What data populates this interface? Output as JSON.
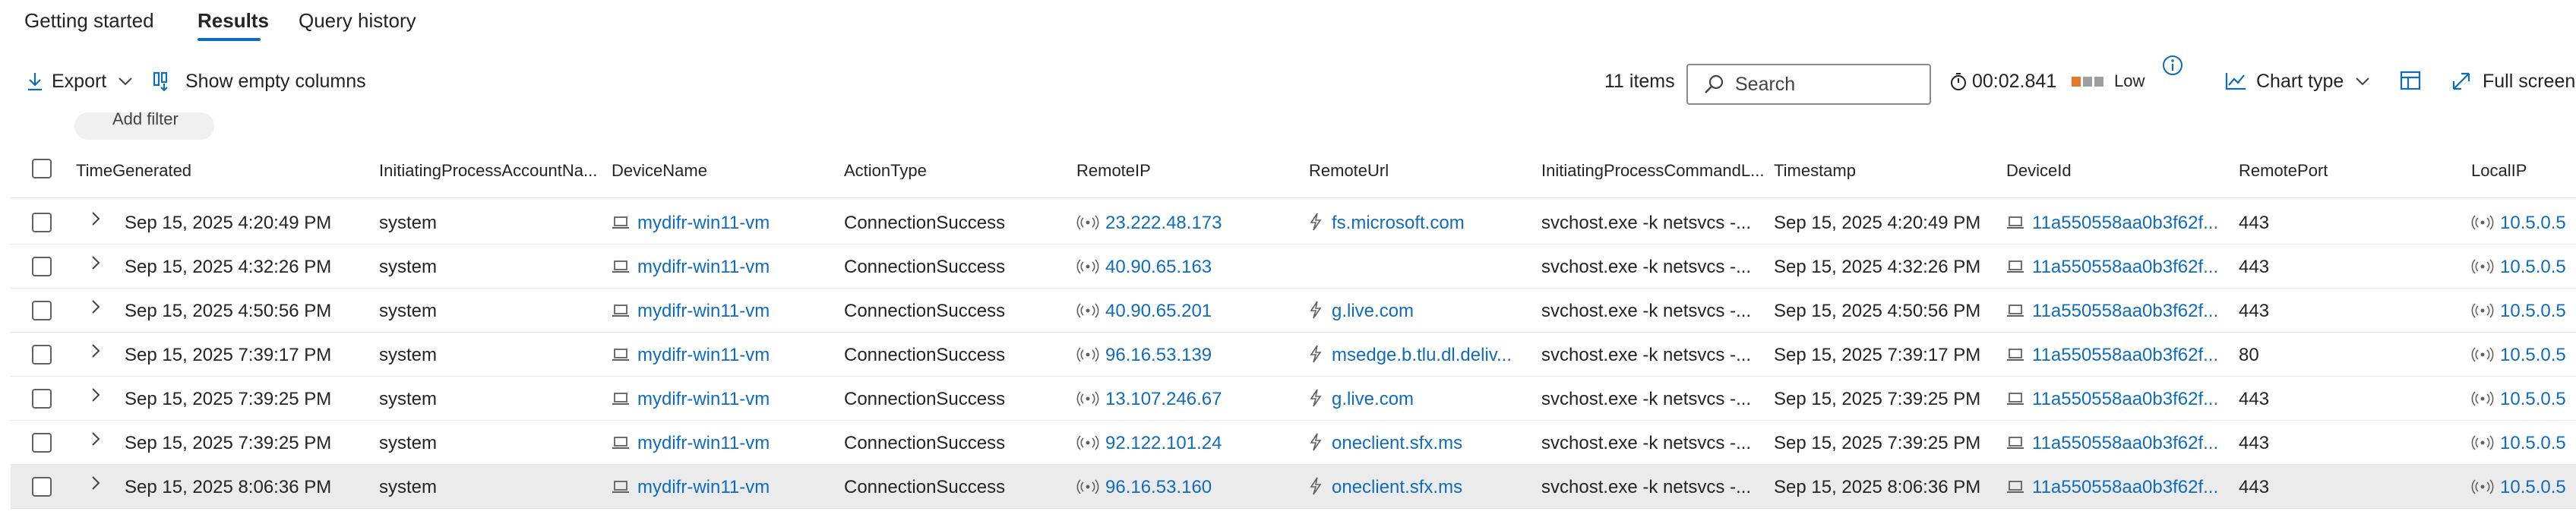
{
  "tabs": [
    {
      "label": "Getting started"
    },
    {
      "label": "Results"
    },
    {
      "label": "Query history"
    }
  ],
  "toolbar": {
    "export_label": "Export",
    "show_empty_label": "Show empty columns",
    "items_count": "11 items",
    "search_placeholder": "Search",
    "duration": "00:02.841",
    "level": "Low",
    "chart_type_label": "Chart type",
    "full_screen_label": "Full screen",
    "add_filter_label": "Add filter"
  },
  "columns": [
    "TimeGenerated",
    "InitiatingProcessAccountNa...",
    "DeviceName",
    "ActionType",
    "RemoteIP",
    "RemoteUrl",
    "InitiatingProcessCommandL...",
    "Timestamp",
    "DeviceId",
    "RemotePort",
    "LocalIP"
  ],
  "rows": [
    {
      "time": "Sep 15, 2025 4:20:49 PM",
      "account": "system",
      "device": "mydifr-win11-vm",
      "action": "ConnectionSuccess",
      "ip": "23.222.48.173",
      "url": "fs.microsoft.com",
      "cmd": "svchost.exe -k netsvcs -...",
      "ts": "Sep 15, 2025 4:20:49 PM",
      "devid": "11a550558aa0b3f62f...",
      "port": "443",
      "local": "10.5.0.5"
    },
    {
      "time": "Sep 15, 2025 4:32:26 PM",
      "account": "system",
      "device": "mydifr-win11-vm",
      "action": "ConnectionSuccess",
      "ip": "40.90.65.163",
      "url": "",
      "cmd": "svchost.exe -k netsvcs -...",
      "ts": "Sep 15, 2025 4:32:26 PM",
      "devid": "11a550558aa0b3f62f...",
      "port": "443",
      "local": "10.5.0.5"
    },
    {
      "time": "Sep 15, 2025 4:50:56 PM",
      "account": "system",
      "device": "mydifr-win11-vm",
      "action": "ConnectionSuccess",
      "ip": "40.90.65.201",
      "url": "g.live.com",
      "cmd": "svchost.exe -k netsvcs -...",
      "ts": "Sep 15, 2025 4:50:56 PM",
      "devid": "11a550558aa0b3f62f...",
      "port": "443",
      "local": "10.5.0.5"
    },
    {
      "time": "Sep 15, 2025 7:39:17 PM",
      "account": "system",
      "device": "mydifr-win11-vm",
      "action": "ConnectionSuccess",
      "ip": "96.16.53.139",
      "url": "msedge.b.tlu.dl.deliv...",
      "cmd": "svchost.exe -k netsvcs -...",
      "ts": "Sep 15, 2025 7:39:17 PM",
      "devid": "11a550558aa0b3f62f...",
      "port": "80",
      "local": "10.5.0.5"
    },
    {
      "time": "Sep 15, 2025 7:39:25 PM",
      "account": "system",
      "device": "mydifr-win11-vm",
      "action": "ConnectionSuccess",
      "ip": "13.107.246.67",
      "url": "g.live.com",
      "cmd": "svchost.exe -k netsvcs -...",
      "ts": "Sep 15, 2025 7:39:25 PM",
      "devid": "11a550558aa0b3f62f...",
      "port": "443",
      "local": "10.5.0.5"
    },
    {
      "time": "Sep 15, 2025 7:39:25 PM",
      "account": "system",
      "device": "mydifr-win11-vm",
      "action": "ConnectionSuccess",
      "ip": "92.122.101.24",
      "url": "oneclient.sfx.ms",
      "cmd": "svchost.exe -k netsvcs -...",
      "ts": "Sep 15, 2025 7:39:25 PM",
      "devid": "11a550558aa0b3f62f...",
      "port": "443",
      "local": "10.5.0.5"
    },
    {
      "time": "Sep 15, 2025 8:06:36 PM",
      "account": "system",
      "device": "mydifr-win11-vm",
      "action": "ConnectionSuccess",
      "ip": "96.16.53.160",
      "url": "oneclient.sfx.ms",
      "cmd": "svchost.exe -k netsvcs -...",
      "ts": "Sep 15, 2025 8:06:36 PM",
      "devid": "11a550558aa0b3f62f...",
      "port": "443",
      "local": "10.5.0.5"
    }
  ],
  "colors": {
    "accent": "#0f6cbd",
    "level_high": "#e8772e",
    "level_off": "#9e9e9e",
    "selected_row": "#ebebeb"
  }
}
